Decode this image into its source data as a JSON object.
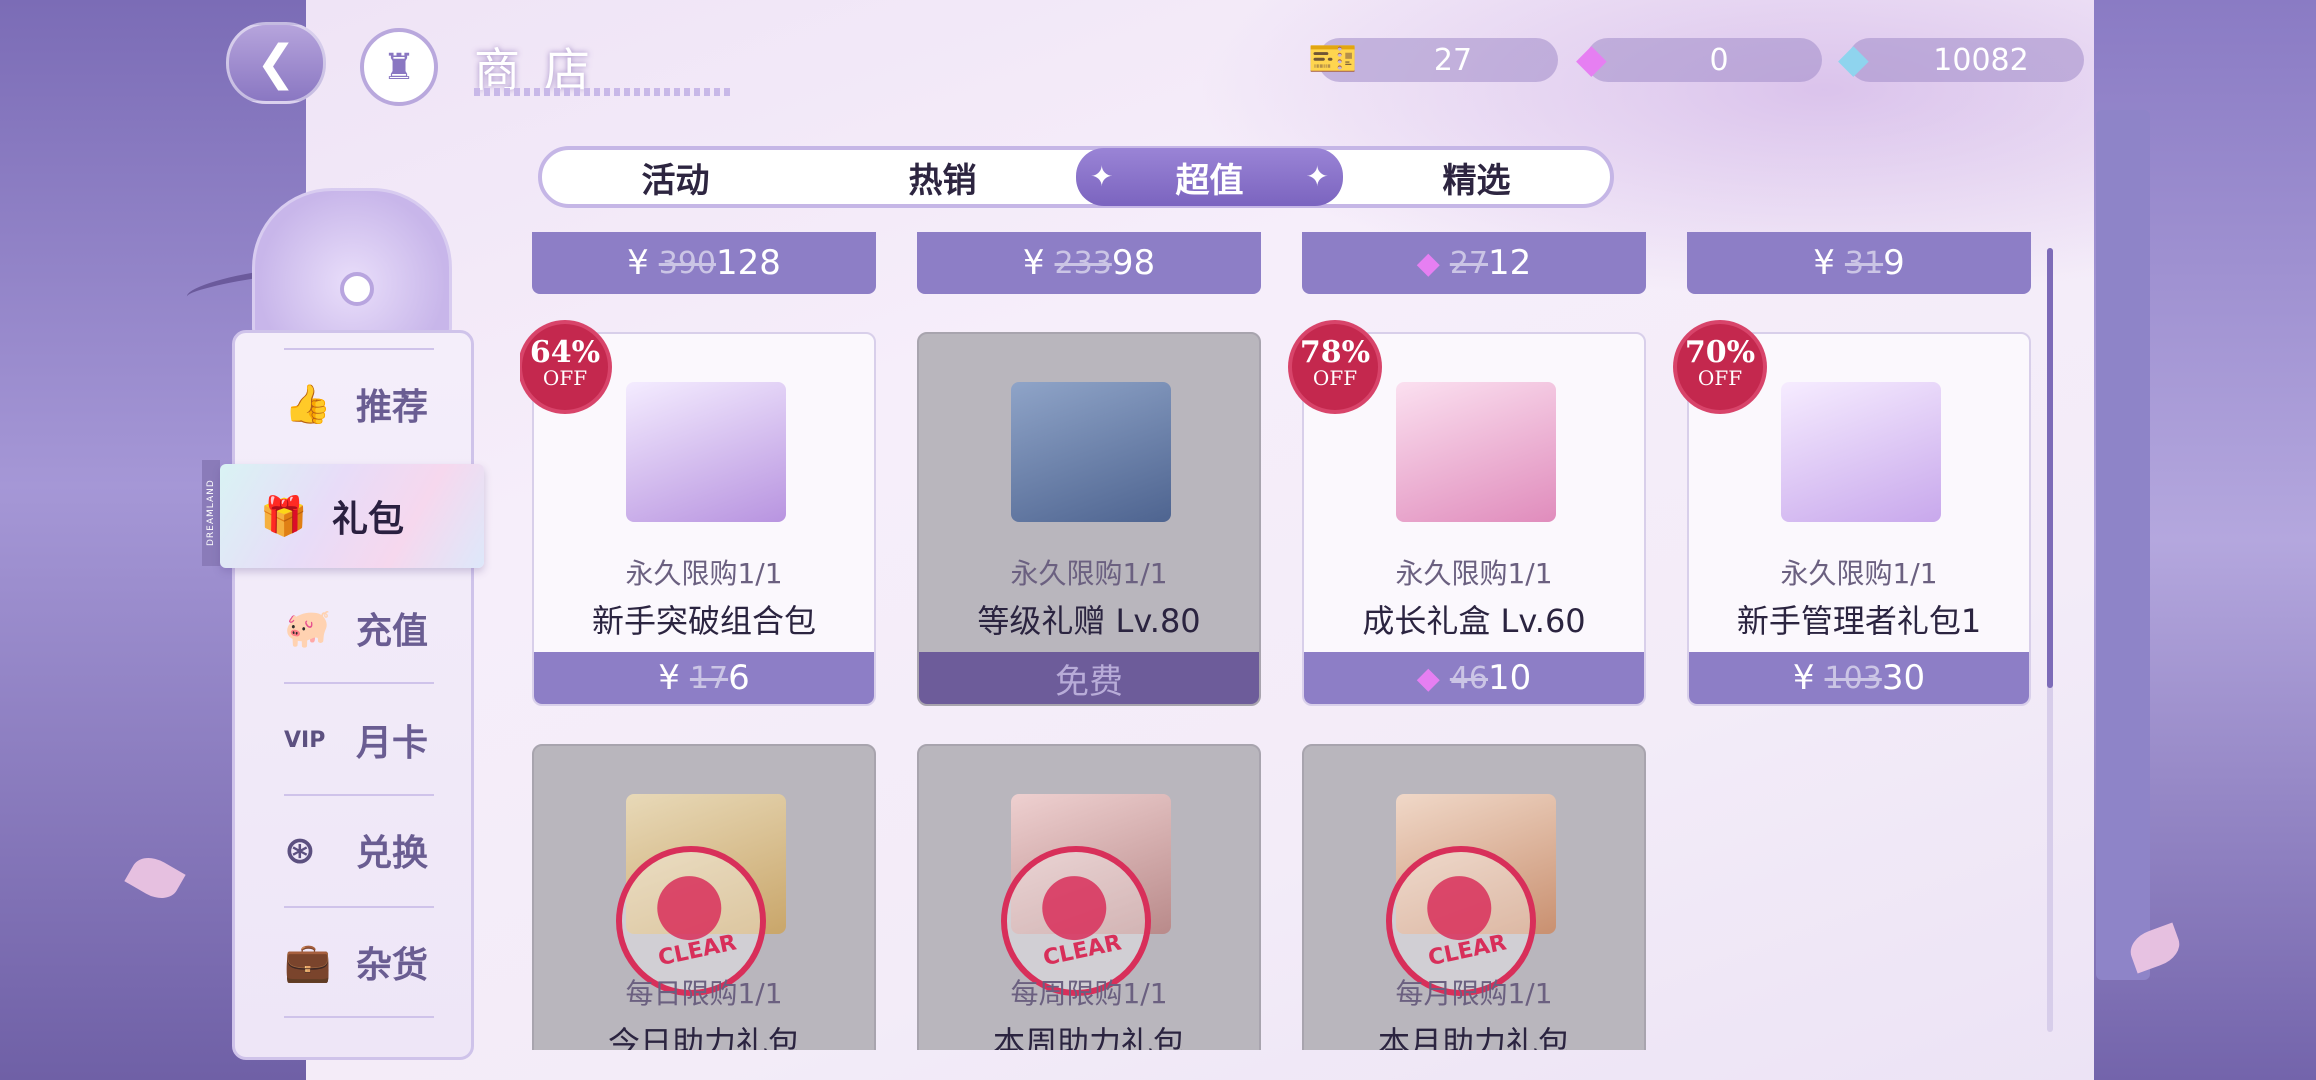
{
  "header": {
    "title": "商店",
    "back_icon": "back-arrow-icon",
    "home_icon": "castle-icon"
  },
  "currencies": [
    {
      "icon": "ticket-icon",
      "value": "27"
    },
    {
      "icon": "pink-gem-icon",
      "value": "0"
    },
    {
      "icon": "diamond-icon",
      "value": "10082"
    }
  ],
  "tabs": [
    {
      "label": "活动",
      "active": false
    },
    {
      "label": "热销",
      "active": false
    },
    {
      "label": "超值",
      "active": true
    },
    {
      "label": "精选",
      "active": false
    }
  ],
  "sidebar": {
    "brand": "DREAMLAND",
    "items": [
      {
        "label": "推荐",
        "icon": "thumbs-up-icon"
      },
      {
        "label": "礼包",
        "icon": "gift-icon",
        "active": true
      },
      {
        "label": "充值",
        "icon": "piggy-bank-icon"
      },
      {
        "label": "月卡",
        "icon": "vip-card-icon"
      },
      {
        "label": "兑换",
        "icon": "exchange-icon"
      },
      {
        "label": "杂货",
        "icon": "briefcase-icon"
      }
    ]
  },
  "top_row_prices": [
    {
      "currency": "¥",
      "old": "390",
      "new": "128"
    },
    {
      "currency": "¥",
      "old": "233",
      "new": "98"
    },
    {
      "currency": "gem",
      "old": "27",
      "new": "12"
    },
    {
      "currency": "¥",
      "old": "31",
      "new": "9"
    }
  ],
  "cards": [
    {
      "discount": "64%",
      "off": "OFF",
      "limit": "永久限购1/1",
      "name": "新手突破组合包",
      "currency": "¥",
      "old": "17",
      "new": "6",
      "colors": {
        "box": "#b894e0"
      }
    },
    {
      "discount": "",
      "off": "",
      "limit": "永久限购1/1",
      "name": "等级礼赠 Lv.80",
      "price_free": "免费",
      "colors": {
        "box": "#5b7398"
      }
    },
    {
      "discount": "78%",
      "off": "OFF",
      "limit": "永久限购1/1",
      "name": "成长礼盒 Lv.60",
      "currency": "gem",
      "old": "46",
      "new": "10",
      "colors": {
        "box": "#e89cc8"
      }
    },
    {
      "discount": "70%",
      "off": "OFF",
      "limit": "永久限购1/1",
      "name": "新手管理者礼包1",
      "currency": "¥",
      "old": "103",
      "new": "30",
      "colors": {
        "box": "#c8a8ec"
      }
    }
  ],
  "sold_cards": [
    {
      "limit": "每日限购1/1",
      "name": "今日助力礼包",
      "stamp": "CLEAR"
    },
    {
      "limit": "每周限购1/1",
      "name": "本周助力礼包",
      "stamp": "CLEAR"
    },
    {
      "limit": "每月限购1/1",
      "name": "本月助力礼包",
      "stamp": "CLEAR"
    }
  ]
}
